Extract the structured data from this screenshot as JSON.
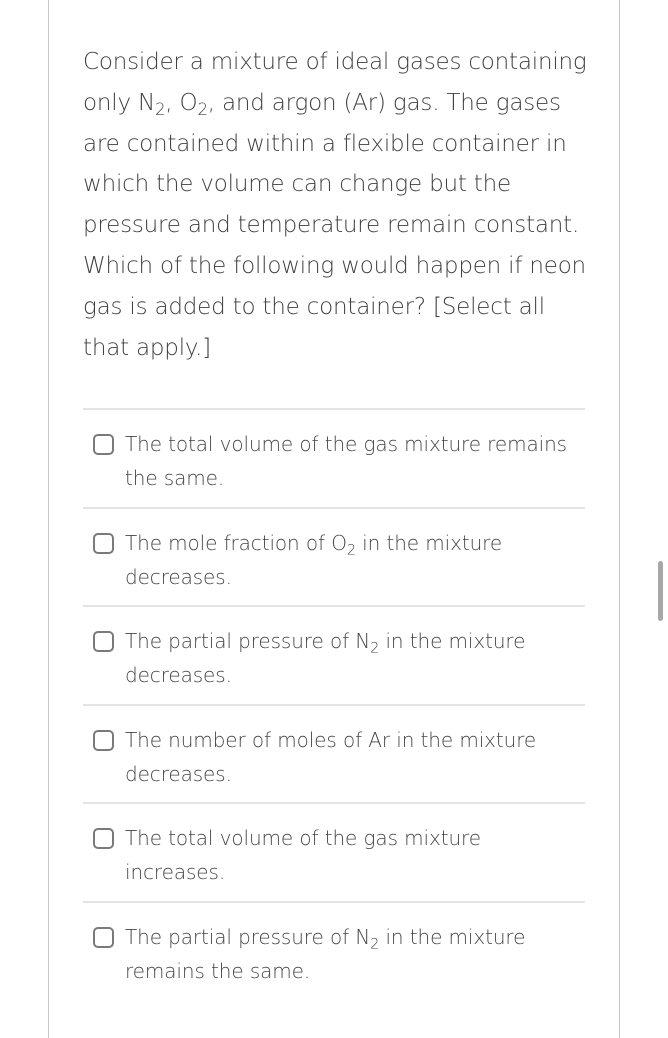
{
  "question": {
    "parts": [
      {
        "t": "Consider a mixture of ideal gases containing only N"
      },
      {
        "sub": "2"
      },
      {
        "t": ", O"
      },
      {
        "sub": "2"
      },
      {
        "t": ", and argon (Ar) gas. The gases are contained within a flexible container in which the volume can change but the pressure and temperature remain constant. Which of the following would happen if neon gas is added to the container? [Select all that apply.]"
      }
    ]
  },
  "options": [
    {
      "parts": [
        {
          "t": "The total volume of the gas mixture remains the same."
        }
      ],
      "checked": false
    },
    {
      "parts": [
        {
          "t": "The mole fraction of O"
        },
        {
          "sub": "2"
        },
        {
          "t": " in the mixture decreases."
        }
      ],
      "checked": false
    },
    {
      "parts": [
        {
          "t": "The partial pressure of N"
        },
        {
          "sub": "2"
        },
        {
          "t": " in the mixture decreases."
        }
      ],
      "checked": false
    },
    {
      "parts": [
        {
          "t": "The number of moles of Ar in the mixture decreases."
        }
      ],
      "checked": false
    },
    {
      "parts": [
        {
          "t": "The total volume of the gas mixture increases."
        }
      ],
      "checked": false
    },
    {
      "parts": [
        {
          "t": "The partial pressure of N"
        },
        {
          "sub": "2"
        },
        {
          "t": " in the mixture remains the same."
        }
      ],
      "checked": false
    }
  ]
}
